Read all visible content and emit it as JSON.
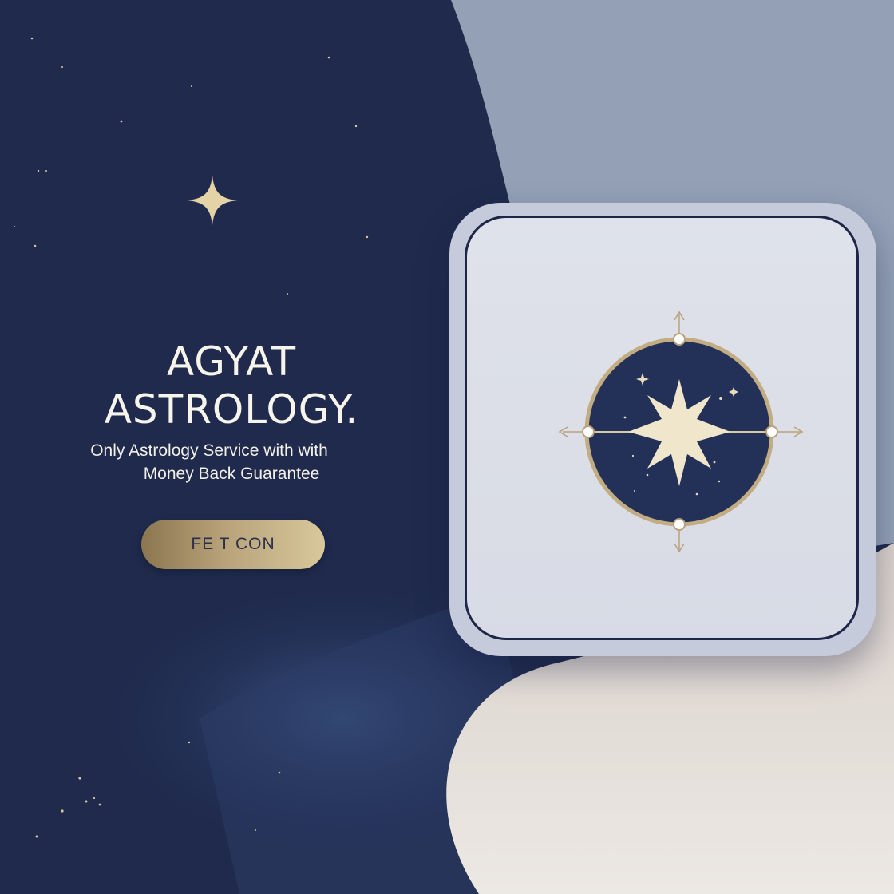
{
  "hero": {
    "title_line1": "AGYAT",
    "title_line2": "ASTROLOGY.",
    "tagline_line1": "Only Astrology Service with with",
    "tagline_line2": "Money Back Guarantee",
    "cta_label": "FE T CON"
  },
  "icons": {
    "sparkle": "four-point-star-icon",
    "emblem": "compass-star-emblem-icon"
  },
  "colors": {
    "navy_background": "#1f2a4d",
    "slate_panel": "#93a0b6",
    "cream_circle": "#e6e0dc",
    "gold_accent": "#c8b48a",
    "device_body": "#c6cbdc",
    "device_screen": "#dcdfe7",
    "text_light": "#f7f4ec"
  }
}
